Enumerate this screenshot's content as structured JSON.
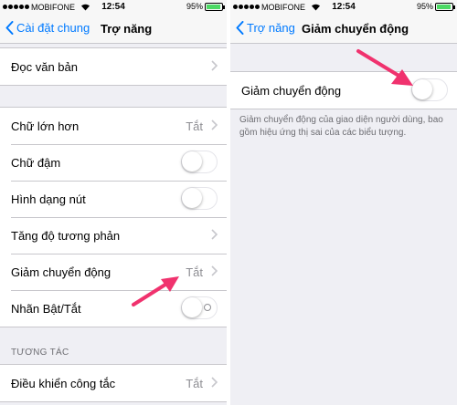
{
  "status_bar": {
    "carrier": "MOBIFONE",
    "time": "12:54",
    "battery": "95%",
    "battery_level": 0.95
  },
  "left": {
    "nav": {
      "back_label": "Cài đặt chung",
      "title": "Trợ năng"
    },
    "group1": [
      {
        "label": "Đọc văn bản"
      }
    ],
    "group2": [
      {
        "label": "Chữ lớn hơn",
        "value": "Tắt"
      },
      {
        "label": "Chữ đậm",
        "toggle": false
      },
      {
        "label": "Hình dạng nút",
        "toggle": false
      },
      {
        "label": "Tăng độ tương phản"
      },
      {
        "label": "Giảm chuyển động",
        "value": "Tắt"
      },
      {
        "label": "Nhãn Bật/Tắt",
        "toggle": false
      }
    ],
    "section_header": "TƯƠNG TÁC",
    "group3": [
      {
        "label": "Điều khiển công tắc",
        "value": "Tắt"
      }
    ]
  },
  "right": {
    "nav": {
      "back_label": "Trợ năng",
      "title": "Giảm chuyển động"
    },
    "row": {
      "label": "Giảm chuyển động",
      "toggle": false
    },
    "footer": "Giảm chuyển động của giao diện người dùng, bao gồm hiệu ứng thị sai của các biểu tượng."
  },
  "colors": {
    "accent": "#007aff",
    "annotation_arrow": "#f0326e",
    "background": "#efeff4"
  },
  "icons": [
    "signal-dots-icon",
    "wifi-icon",
    "battery-icon",
    "back-chevron-icon",
    "chevron-right-icon",
    "arrow-annotation-icon"
  ]
}
